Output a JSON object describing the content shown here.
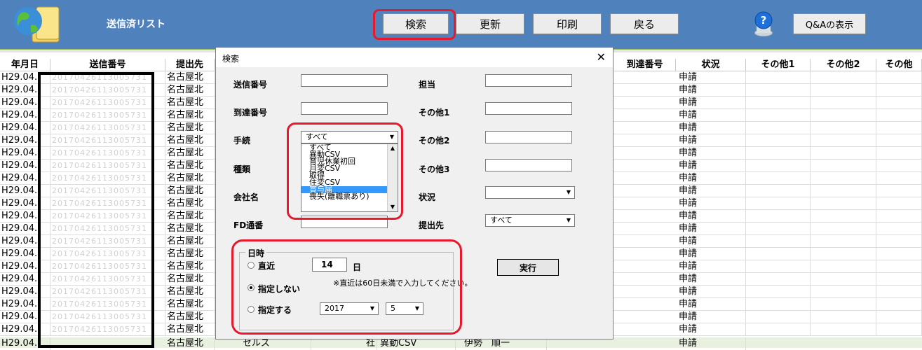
{
  "header": {
    "app_title": "送信済リスト",
    "buttons": {
      "search": "検索",
      "update": "更新",
      "print": "印刷",
      "back": "戻る",
      "qa": "Q&Aの表示"
    },
    "logo_icon": "globe-folder-icon",
    "help_icon": "help-question-icon"
  },
  "grid": {
    "columns": [
      "年月日",
      "送信番号",
      "提出先",
      "到達番号",
      "状況",
      "その他1",
      "その他2",
      "その他"
    ],
    "rows": [
      {
        "date": "H29.04.",
        "id": "20170426113005731",
        "dest": "名古屋北",
        "status": "申請"
      },
      {
        "date": "H29.04.",
        "id": "20170426113005731",
        "dest": "名古屋北",
        "status": "申請"
      },
      {
        "date": "H29.04.",
        "id": "20170426113005731",
        "dest": "名古屋北",
        "status": "申請"
      },
      {
        "date": "H29.04.",
        "id": "20170426113005731",
        "dest": "名古屋北",
        "status": "申請"
      },
      {
        "date": "H29.04.",
        "id": "20170426113005731",
        "dest": "名古屋北",
        "status": "申請"
      },
      {
        "date": "H29.04.",
        "id": "20170426113005731",
        "dest": "名古屋北",
        "status": "申請"
      },
      {
        "date": "H29.04.",
        "id": "20170426113005731",
        "dest": "名古屋北",
        "status": "申請"
      },
      {
        "date": "H29.04.",
        "id": "20170426113005731",
        "dest": "名古屋北",
        "status": "申請"
      },
      {
        "date": "H29.04.",
        "id": "20170426113005731",
        "dest": "名古屋北",
        "status": "申請"
      },
      {
        "date": "H29.04.",
        "id": "20170426113005731",
        "dest": "名古屋北",
        "status": "申請"
      },
      {
        "date": "H29.04.",
        "id": "20170426113005731",
        "dest": "名古屋北",
        "status": "申請"
      },
      {
        "date": "H29.04.",
        "id": "20170426113005731",
        "dest": "名古屋北",
        "status": "申請"
      },
      {
        "date": "H29.04.",
        "id": "20170426113005731",
        "dest": "名古屋北",
        "status": "申請"
      },
      {
        "date": "H29.04.",
        "id": "20170426113005731",
        "dest": "名古屋北",
        "status": "申請"
      },
      {
        "date": "H29.04.",
        "id": "20170426113005731",
        "dest": "名古屋北",
        "status": "申請"
      },
      {
        "date": "H29.04.",
        "id": "20170426113005731",
        "dest": "名古屋北",
        "status": "申請"
      },
      {
        "date": "H29.04.",
        "id": "20170426113005731",
        "dest": "名古屋北",
        "status": "申請"
      },
      {
        "date": "H29.04.",
        "id": "20170426113005731",
        "dest": "名古屋北",
        "status": "申請"
      },
      {
        "date": "H29.04.",
        "id": "20170426113005731",
        "dest": "名古屋北",
        "status": "申請"
      },
      {
        "date": "H29.04.",
        "id": "20170426113005731",
        "dest": "名古屋北",
        "status": "申請"
      },
      {
        "date": "H29.04.",
        "id": "20170426113005731",
        "dest": "名古屋北",
        "status": "申請"
      }
    ],
    "last_row": {
      "date": "H29.04.",
      "dest": "名古屋北",
      "col3": "セルズ",
      "col4": "社",
      "col5": "異動CSV",
      "col6": "伊勢　順一",
      "status": "申請"
    }
  },
  "dialog": {
    "title": "検索",
    "labels": {
      "send_no": "送信番号",
      "arrival_no": "到達番号",
      "procedure": "手続",
      "kind": "種類",
      "company": "会社名",
      "fd": "FD通番",
      "owner": "担当",
      "other1": "その他1",
      "other2": "その他2",
      "other3": "その他3",
      "status": "状況",
      "dest": "提出先"
    },
    "procedure_value": "すべて",
    "procedure_options": [
      "すべて",
      "異動CSV",
      "育児休業初回",
      "月変CSV",
      "取得",
      "住変CSV",
      "賞与届",
      "喪失(離職票あり)"
    ],
    "procedure_selected_index": 6,
    "dest_value": "すべて",
    "status_value": "",
    "datetime": {
      "group_title": "日時",
      "recent_label": "直近",
      "recent_days": "14",
      "day_unit": "日",
      "note": "※直近は60日未満で入力してください。",
      "none_label": "指定しない",
      "specify_label": "指定する",
      "year": "2017",
      "month": "5",
      "selected": "none"
    },
    "exec_label": "実行"
  }
}
